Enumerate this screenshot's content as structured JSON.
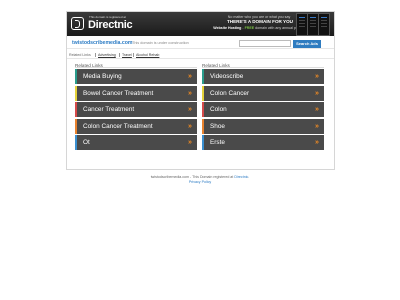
{
  "banner": {
    "logo_small": "This domain is registered at",
    "logo_name": "Directnic",
    "tagline_1": "No matter who you are or what you say",
    "tagline_2": "THERE'S A DOMAIN FOR YOU",
    "tagline_3_bold": "Website Hosting",
    "tagline_3_free": "FREE",
    "tagline_3_rest": "domain with any annual plan"
  },
  "domain_bar": {
    "domain": "twistodscribemedia.com",
    "note": "This domain is under construction",
    "search_placeholder": "",
    "search_button": "Search Ads"
  },
  "related_strip": {
    "label": "Related Links",
    "links": [
      "Advertising",
      "Travel",
      "Alcohol Rehab"
    ]
  },
  "left_column": {
    "title": "Related Links",
    "items": [
      {
        "label": "Media Buying",
        "color": "#2a9c8c"
      },
      {
        "label": "Bowel Cancer Treatment",
        "color": "#e4d23a"
      },
      {
        "label": "Cancer Treatment",
        "color": "#d64a4a"
      },
      {
        "label": "Colon Cancer Treatment",
        "color": "#e8822e"
      },
      {
        "label": "Ot",
        "color": "#3a8fd0"
      }
    ]
  },
  "right_column": {
    "title": "Related Links",
    "items": [
      {
        "label": "Videoscribe",
        "color": "#2a9c8c"
      },
      {
        "label": "Colon Cancer",
        "color": "#e4d23a"
      },
      {
        "label": "Colon",
        "color": "#d64a4a"
      },
      {
        "label": "Shoe",
        "color": "#e8822e"
      },
      {
        "label": "Erste",
        "color": "#3a8fd0"
      }
    ]
  },
  "arrow_glyph": "»",
  "footer": {
    "line_1_prefix": "twistodscribemedia.com - This Domain registered at",
    "line_1_link": "Directnic",
    "privacy": "Privacy Policy"
  }
}
